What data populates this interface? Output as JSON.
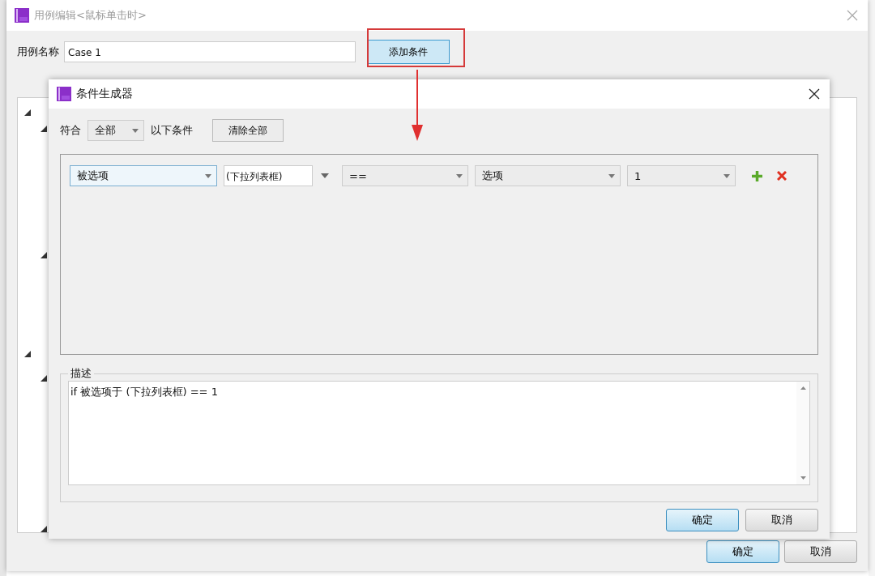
{
  "case_editor": {
    "title": "用例编辑<鼠标单击时>",
    "case_name_label": "用例名称",
    "case_name_value": "Case 1",
    "add_condition_button": "添加条件",
    "buttons": [
      {
        "label": "确定",
        "default": true
      },
      {
        "label": "取消",
        "default": false
      }
    ]
  },
  "condition_builder": {
    "title": "条件生成器",
    "match_label": "符合",
    "match_value": "全部",
    "match_suffix": "以下条件",
    "clear_button": "清除全部",
    "conditions": [
      {
        "fields": [
          {
            "kind": "select",
            "value": "被选项",
            "focused": true
          },
          {
            "kind": "target",
            "value": "(下拉列表框)",
            "focused": false
          },
          {
            "kind": "select",
            "value": "==",
            "focused": false
          },
          {
            "kind": "select",
            "value": "选项",
            "focused": false
          },
          {
            "kind": "select",
            "value": "1",
            "focused": false
          }
        ]
      }
    ],
    "description_label": "描述",
    "description": "if 被选项于 (下拉列表框) == 1",
    "buttons": [
      {
        "label": "确定",
        "default": true
      },
      {
        "label": "取消",
        "default": false
      }
    ]
  }
}
